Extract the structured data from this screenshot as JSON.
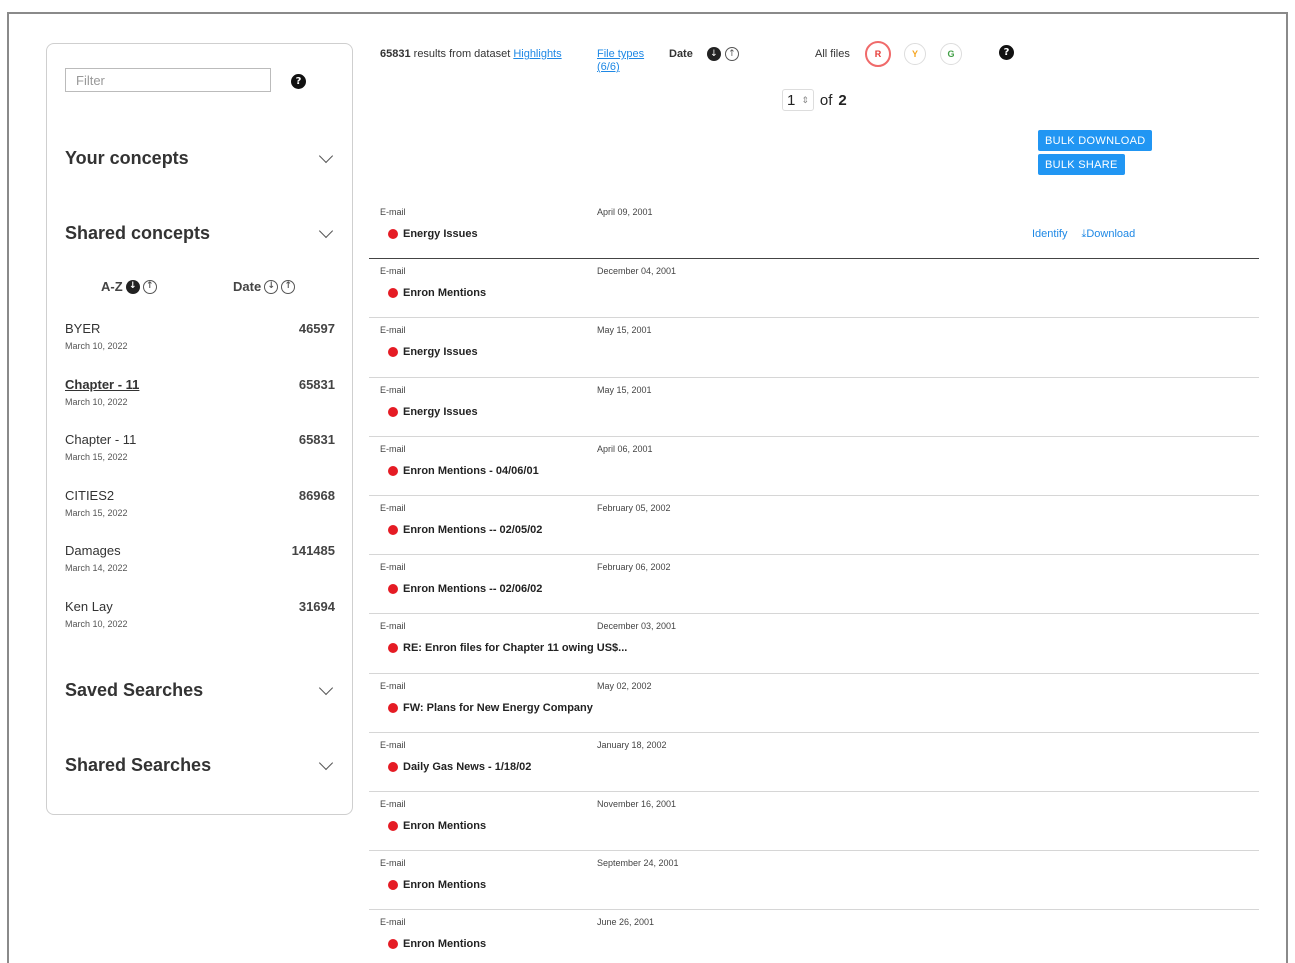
{
  "sidebar": {
    "filter_placeholder": "Filter",
    "help_glyph": "?",
    "sections": {
      "your_concepts": "Your concepts",
      "shared_concepts": "Shared concepts",
      "saved_searches": "Saved Searches",
      "shared_searches": "Shared Searches"
    },
    "sort": {
      "az_label": "A-Z",
      "date_label": "Date"
    },
    "concepts": [
      {
        "name": "BYER",
        "date": "March 10, 2022",
        "count": "46597",
        "selected": false
      },
      {
        "name": "Chapter - 11",
        "date": "March 10, 2022",
        "count": "65831",
        "selected": true
      },
      {
        "name": "Chapter - 11",
        "date": "March 15, 2022",
        "count": "65831",
        "selected": false
      },
      {
        "name": "CITIES2",
        "date": "March 15, 2022",
        "count": "86968",
        "selected": false
      },
      {
        "name": "Damages",
        "date": "March 14, 2022",
        "count": "141485",
        "selected": false
      },
      {
        "name": "Ken Lay",
        "date": "March 10, 2022",
        "count": "31694",
        "selected": false
      }
    ]
  },
  "topbar": {
    "result_count": "65831",
    "results_text": " results from dataset ",
    "dataset_link": "Highlights",
    "file_types_link": "File types",
    "file_types_count": "(6/6)",
    "date_label": "Date",
    "all_files_label": "All files",
    "rag": {
      "r": "R",
      "y": "Y",
      "g": "G"
    },
    "help_glyph": "?"
  },
  "pager": {
    "current_page": "1",
    "of_label": "of",
    "total_pages": "2"
  },
  "bulk": {
    "download_label": "BULK DOWNLOAD",
    "share_label": "BULK SHARE"
  },
  "row_actions": {
    "identify": "Identify",
    "download": "Download"
  },
  "status_color": "#e51b24",
  "accent_color": "#2196f3",
  "results": [
    {
      "type": "E-mail",
      "date": "April 09, 2001",
      "title": "Energy Issues"
    },
    {
      "type": "E-mail",
      "date": "December 04, 2001",
      "title": "Enron Mentions"
    },
    {
      "type": "E-mail",
      "date": "May 15, 2001",
      "title": "Energy Issues"
    },
    {
      "type": "E-mail",
      "date": "May 15, 2001",
      "title": "Energy Issues"
    },
    {
      "type": "E-mail",
      "date": "April 06, 2001",
      "title": "Enron Mentions - 04/06/01"
    },
    {
      "type": "E-mail",
      "date": "February 05, 2002",
      "title": "Enron Mentions -- 02/05/02"
    },
    {
      "type": "E-mail",
      "date": "February 06, 2002",
      "title": "Enron Mentions -- 02/06/02"
    },
    {
      "type": "E-mail",
      "date": "December 03, 2001",
      "title": "RE: Enron files for Chapter 11 owing US$..."
    },
    {
      "type": "E-mail",
      "date": "May 02, 2002",
      "title": "FW: Plans for New Energy Company"
    },
    {
      "type": "E-mail",
      "date": "January 18, 2002",
      "title": "Daily Gas News - 1/18/02"
    },
    {
      "type": "E-mail",
      "date": "November 16, 2001",
      "title": "Enron Mentions"
    },
    {
      "type": "E-mail",
      "date": "September 24, 2001",
      "title": "Enron Mentions"
    },
    {
      "type": "E-mail",
      "date": "June 26, 2001",
      "title": "Enron Mentions"
    }
  ]
}
